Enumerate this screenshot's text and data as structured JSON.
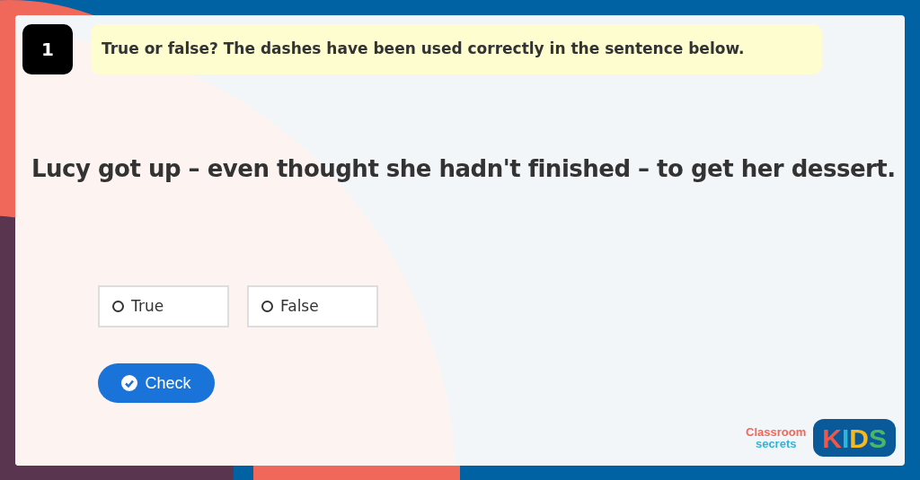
{
  "question": {
    "number": "1",
    "prompt": "True or false? The dashes have been used correctly in the sentence below."
  },
  "sentence": "Lucy got up – even thought she hadn't finished – to get her dessert.",
  "options": [
    {
      "label": "True",
      "selected": false
    },
    {
      "label": "False",
      "selected": false
    }
  ],
  "check_button": "Check",
  "logo": {
    "line_1": "Classroom",
    "line_2": "secrets",
    "badge": "KIDS"
  }
}
